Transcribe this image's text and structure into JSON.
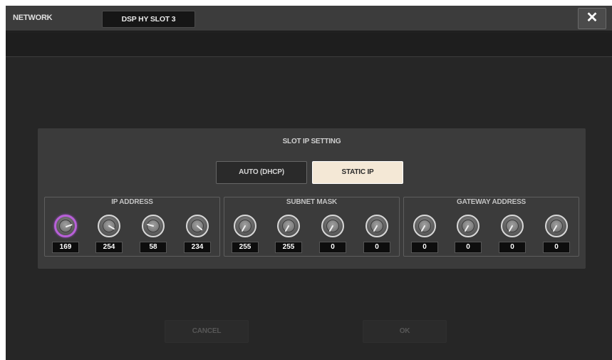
{
  "window": {
    "title": "NETWORK",
    "slot_tab": "DSP HY SLOT 3",
    "close_icon": "close-icon",
    "close_symbol": "✕"
  },
  "slot_ip": {
    "title": "SLOT IP SETTING",
    "mode_buttons": [
      {
        "label": "AUTO (DHCP)",
        "selected": false
      },
      {
        "label": "STATIC IP",
        "selected": true
      }
    ],
    "groups": [
      {
        "label": "IP ADDRESS",
        "values": [
          "169",
          "254",
          "58",
          "234"
        ]
      },
      {
        "label": "SUBNET MASK",
        "values": [
          "255",
          "255",
          "0",
          "0"
        ]
      },
      {
        "label": "GATEWAY ADDRESS",
        "values": [
          "0",
          "0",
          "0",
          "0"
        ]
      }
    ]
  },
  "footer": {
    "cancel_label": "CANCEL",
    "ok_label": "OK"
  },
  "colors": {
    "background": "#262626",
    "titlebar": "#3c3c3c",
    "panel": "#3b3b3b",
    "selected_button": "#f4e8d6",
    "active_knob_ring": "#b860d8"
  }
}
